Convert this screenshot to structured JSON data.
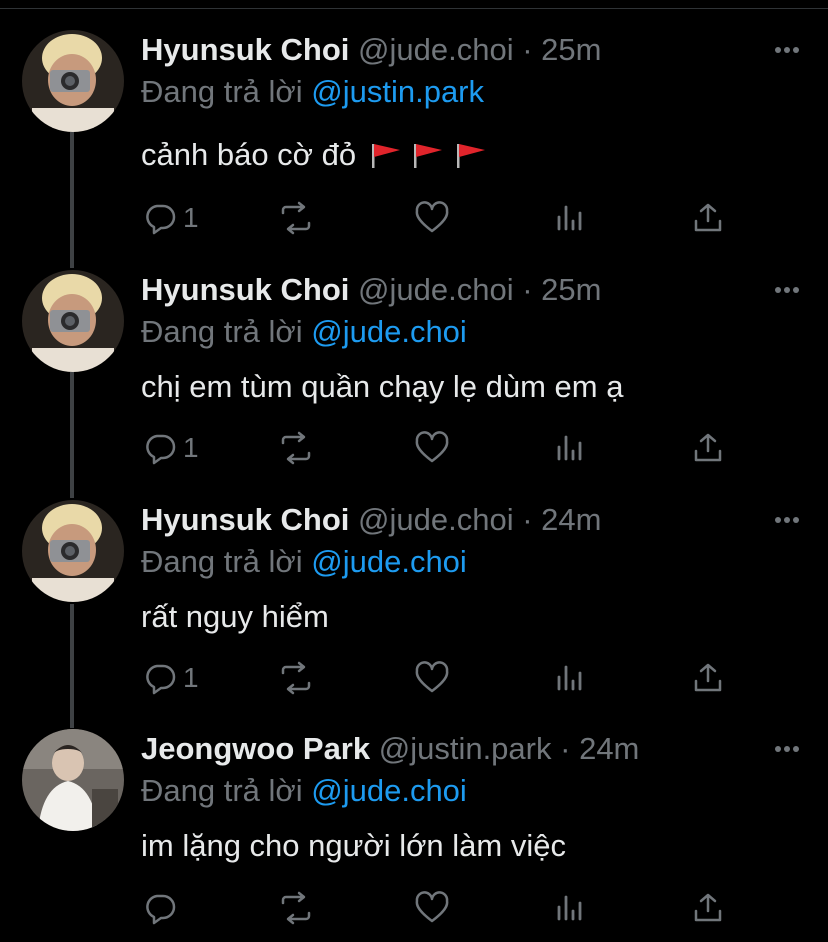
{
  "tweets": [
    {
      "name": "Hyunsuk Choi",
      "handle": "@jude.choi",
      "separator": "·",
      "time": "25m",
      "replying_prefix": "Đang trả lời",
      "replying_to": "@justin.park",
      "text": "cảnh báo cờ đỏ",
      "emoji": [
        "red-flag-icon",
        "red-flag-icon",
        "red-flag-icon"
      ],
      "reply_count": "1"
    },
    {
      "name": "Hyunsuk Choi",
      "handle": "@jude.choi",
      "separator": "·",
      "time": "25m",
      "replying_prefix": "Đang trả lời",
      "replying_to": "@jude.choi",
      "text": "chị em tùm quần chạy lẹ dùm em ạ",
      "reply_count": "1"
    },
    {
      "name": "Hyunsuk Choi",
      "handle": "@jude.choi",
      "separator": "·",
      "time": "24m",
      "replying_prefix": "Đang trả lời",
      "replying_to": "@jude.choi",
      "text": "rất nguy hiểm",
      "reply_count": "1"
    },
    {
      "name": "Jeongwoo Park",
      "handle": "@justin.park",
      "separator": "·",
      "time": "24m",
      "replying_prefix": "Đang trả lời",
      "replying_to": "@jude.choi",
      "text": "im lặng cho người lớn làm việc",
      "reply_count": ""
    }
  ],
  "colors": {
    "background": "#000000",
    "text": "#e7e9ea",
    "secondary": "#71767b",
    "accent": "#1d9bf0",
    "flag": "#e0242b"
  }
}
